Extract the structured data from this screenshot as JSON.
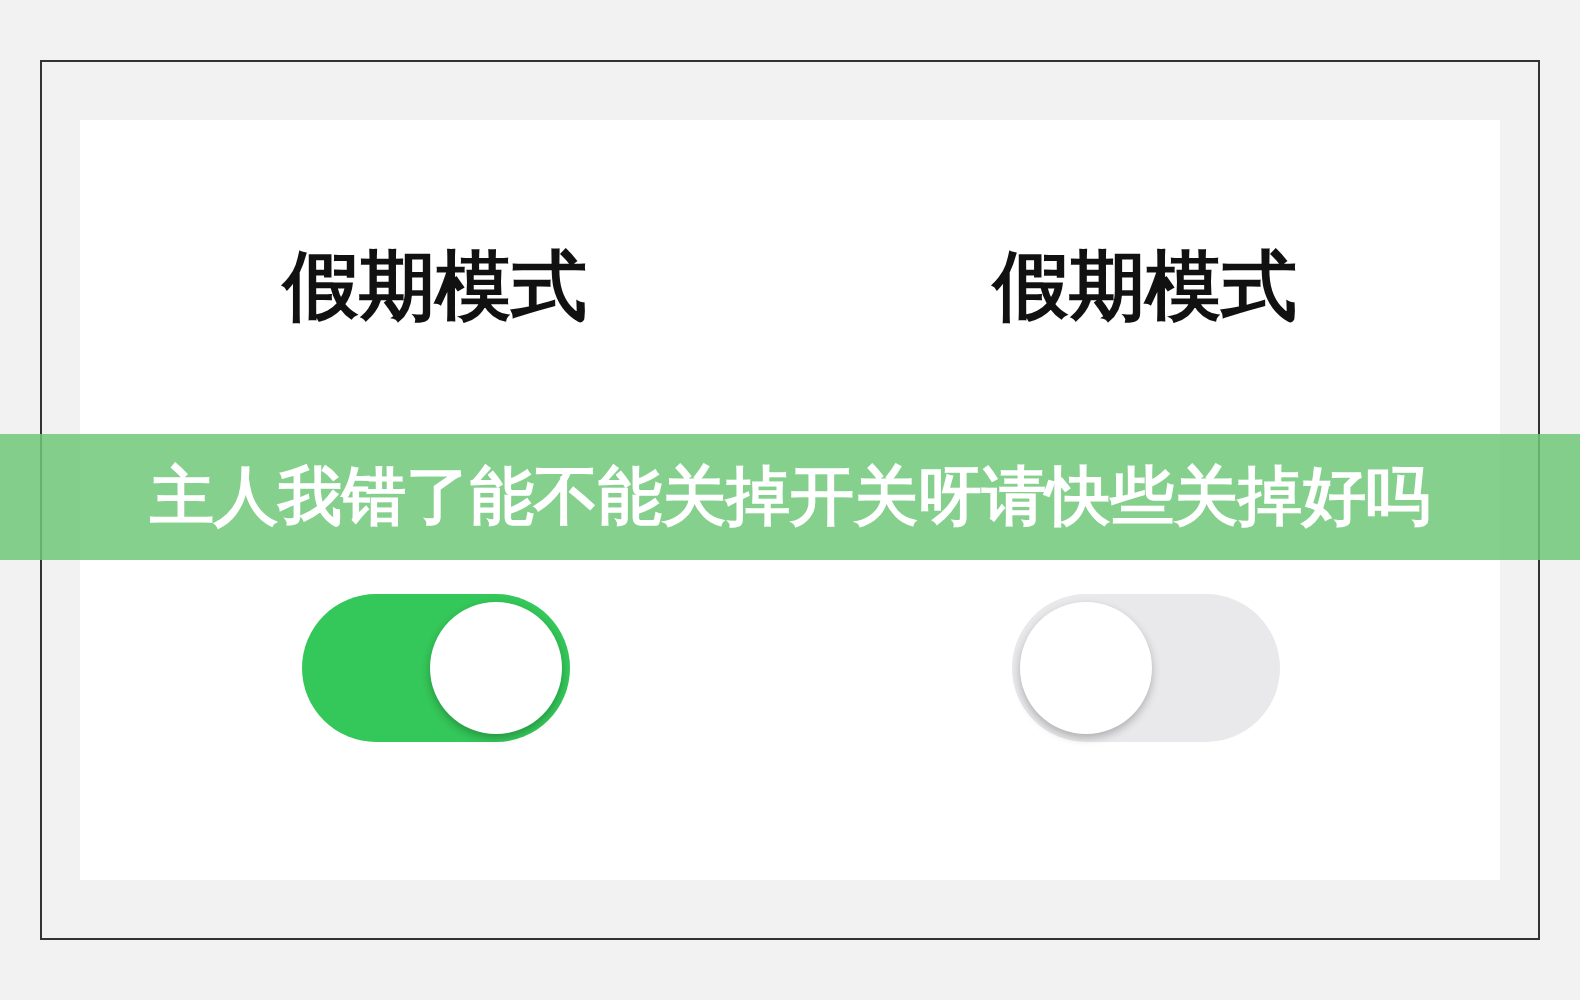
{
  "panels": [
    {
      "title": "假期模式",
      "toggle": {
        "on": true
      }
    },
    {
      "title": "假期模式",
      "toggle": {
        "on": false
      }
    }
  ],
  "banner": {
    "text": "主人我错了能不能关掉开关呀请快些关掉好吗"
  }
}
